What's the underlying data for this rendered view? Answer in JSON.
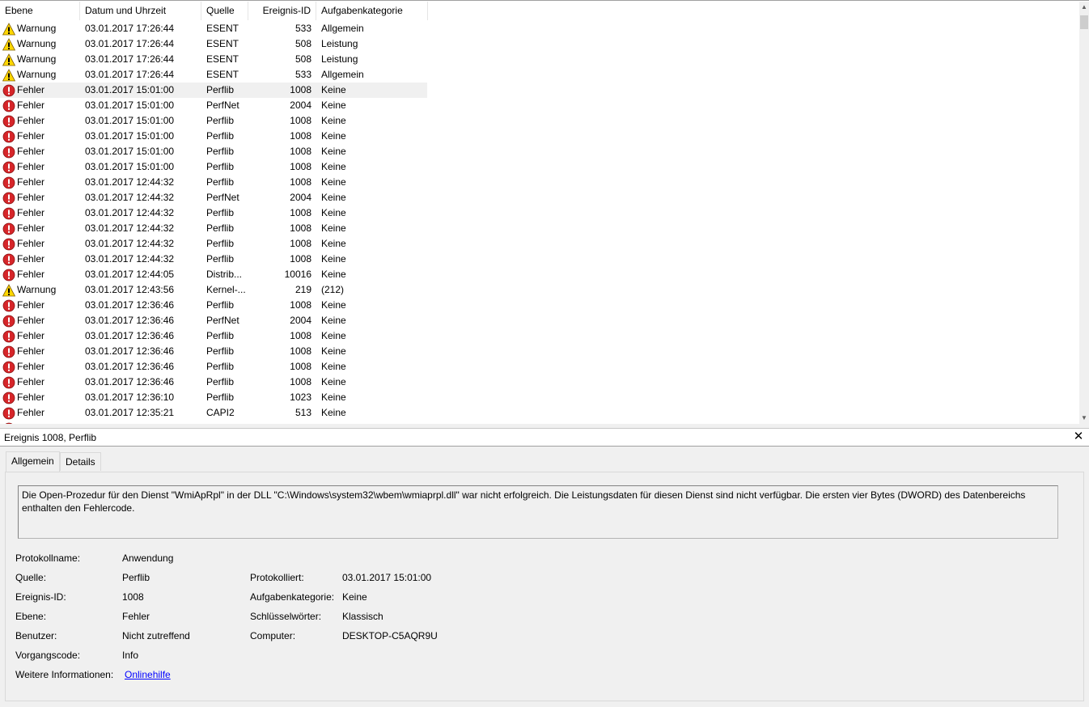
{
  "columns": {
    "level": "Ebene",
    "datetime": "Datum und Uhrzeit",
    "source": "Quelle",
    "event_id": "Ereignis-ID",
    "category": "Aufgabenkategorie"
  },
  "events": [
    {
      "level": "Warnung",
      "type": "warning",
      "datetime": "03.01.2017 17:26:44",
      "source": "ESENT",
      "id": "533",
      "category": "Allgemein"
    },
    {
      "level": "Warnung",
      "type": "warning",
      "datetime": "03.01.2017 17:26:44",
      "source": "ESENT",
      "id": "508",
      "category": "Leistung"
    },
    {
      "level": "Warnung",
      "type": "warning",
      "datetime": "03.01.2017 17:26:44",
      "source": "ESENT",
      "id": "508",
      "category": "Leistung"
    },
    {
      "level": "Warnung",
      "type": "warning",
      "datetime": "03.01.2017 17:26:44",
      "source": "ESENT",
      "id": "533",
      "category": "Allgemein"
    },
    {
      "level": "Fehler",
      "type": "error",
      "selected": true,
      "datetime": "03.01.2017 15:01:00",
      "source": "Perflib",
      "id": "1008",
      "category": "Keine"
    },
    {
      "level": "Fehler",
      "type": "error",
      "datetime": "03.01.2017 15:01:00",
      "source": "PerfNet",
      "id": "2004",
      "category": "Keine"
    },
    {
      "level": "Fehler",
      "type": "error",
      "datetime": "03.01.2017 15:01:00",
      "source": "Perflib",
      "id": "1008",
      "category": "Keine"
    },
    {
      "level": "Fehler",
      "type": "error",
      "datetime": "03.01.2017 15:01:00",
      "source": "Perflib",
      "id": "1008",
      "category": "Keine"
    },
    {
      "level": "Fehler",
      "type": "error",
      "datetime": "03.01.2017 15:01:00",
      "source": "Perflib",
      "id": "1008",
      "category": "Keine"
    },
    {
      "level": "Fehler",
      "type": "error",
      "datetime": "03.01.2017 15:01:00",
      "source": "Perflib",
      "id": "1008",
      "category": "Keine"
    },
    {
      "level": "Fehler",
      "type": "error",
      "datetime": "03.01.2017 12:44:32",
      "source": "Perflib",
      "id": "1008",
      "category": "Keine"
    },
    {
      "level": "Fehler",
      "type": "error",
      "datetime": "03.01.2017 12:44:32",
      "source": "PerfNet",
      "id": "2004",
      "category": "Keine"
    },
    {
      "level": "Fehler",
      "type": "error",
      "datetime": "03.01.2017 12:44:32",
      "source": "Perflib",
      "id": "1008",
      "category": "Keine"
    },
    {
      "level": "Fehler",
      "type": "error",
      "datetime": "03.01.2017 12:44:32",
      "source": "Perflib",
      "id": "1008",
      "category": "Keine"
    },
    {
      "level": "Fehler",
      "type": "error",
      "datetime": "03.01.2017 12:44:32",
      "source": "Perflib",
      "id": "1008",
      "category": "Keine"
    },
    {
      "level": "Fehler",
      "type": "error",
      "datetime": "03.01.2017 12:44:32",
      "source": "Perflib",
      "id": "1008",
      "category": "Keine"
    },
    {
      "level": "Fehler",
      "type": "error",
      "datetime": "03.01.2017 12:44:05",
      "source": "Distrib...",
      "id": "10016",
      "category": "Keine"
    },
    {
      "level": "Warnung",
      "type": "warning",
      "datetime": "03.01.2017 12:43:56",
      "source": "Kernel-...",
      "id": "219",
      "category": "(212)"
    },
    {
      "level": "Fehler",
      "type": "error",
      "datetime": "03.01.2017 12:36:46",
      "source": "Perflib",
      "id": "1008",
      "category": "Keine"
    },
    {
      "level": "Fehler",
      "type": "error",
      "datetime": "03.01.2017 12:36:46",
      "source": "PerfNet",
      "id": "2004",
      "category": "Keine"
    },
    {
      "level": "Fehler",
      "type": "error",
      "datetime": "03.01.2017 12:36:46",
      "source": "Perflib",
      "id": "1008",
      "category": "Keine"
    },
    {
      "level": "Fehler",
      "type": "error",
      "datetime": "03.01.2017 12:36:46",
      "source": "Perflib",
      "id": "1008",
      "category": "Keine"
    },
    {
      "level": "Fehler",
      "type": "error",
      "datetime": "03.01.2017 12:36:46",
      "source": "Perflib",
      "id": "1008",
      "category": "Keine"
    },
    {
      "level": "Fehler",
      "type": "error",
      "datetime": "03.01.2017 12:36:46",
      "source": "Perflib",
      "id": "1008",
      "category": "Keine"
    },
    {
      "level": "Fehler",
      "type": "error",
      "datetime": "03.01.2017 12:36:10",
      "source": "Perflib",
      "id": "1023",
      "category": "Keine"
    },
    {
      "level": "Fehler",
      "type": "error",
      "datetime": "03.01.2017 12:35:21",
      "source": "CAPI2",
      "id": "513",
      "category": "Keine"
    },
    {
      "level": "",
      "type": "error",
      "datetime": "",
      "source": "",
      "id": "",
      "category": ""
    }
  ],
  "detail": {
    "title": "Ereignis 1008, Perflib",
    "tabs": [
      "Allgemein",
      "Details"
    ],
    "description": "Die Open-Prozedur für den Dienst \"WmiApRpl\" in der DLL \"C:\\Windows\\system32\\wbem\\wmiaprpl.dll\" war nicht erfolgreich. Die Leistungsdaten für diesen Dienst sind nicht verfügbar. Die ersten vier Bytes (DWORD) des Datenbereichs enthalten den Fehlercode.",
    "fields": {
      "log_name_label": "Protokollname:",
      "log_name": "Anwendung",
      "source_label": "Quelle:",
      "source": "Perflib",
      "logged_label": "Protokolliert:",
      "logged": "03.01.2017 15:01:00",
      "event_id_label": "Ereignis-ID:",
      "event_id": "1008",
      "task_category_label": "Aufgabenkategorie:",
      "task_category": "Keine",
      "level_label": "Ebene:",
      "level": "Fehler",
      "keywords_label": "Schlüsselwörter:",
      "keywords": "Klassisch",
      "user_label": "Benutzer:",
      "user": "Nicht zutreffend",
      "computer_label": "Computer:",
      "computer": "DESKTOP-C5AQR9U",
      "opcode_label": "Vorgangscode:",
      "opcode": "Info",
      "more_info_label": "Weitere Informationen:",
      "more_info_link": "Onlinehilfe"
    }
  },
  "colors": {
    "warning": "#ffd700",
    "error": "#d6262a",
    "link": "#0000ff",
    "selection": "#f0f0f0"
  },
  "icons": {
    "warning": "warning-triangle-icon",
    "error": "error-circle-icon",
    "close": "close-icon",
    "scroll_up": "chevron-up-icon",
    "scroll_down": "chevron-down-icon"
  }
}
